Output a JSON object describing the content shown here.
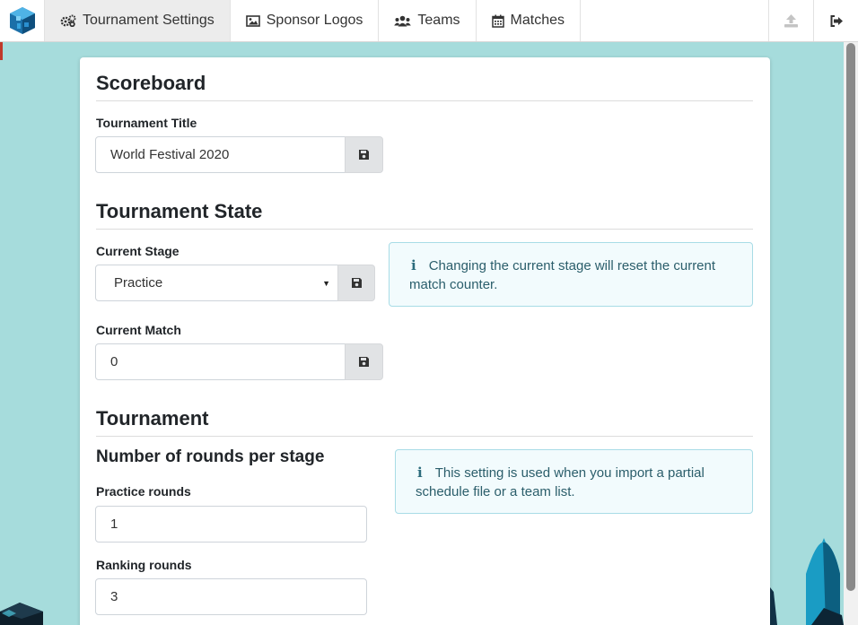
{
  "nav": {
    "tabs": [
      {
        "label": "Tournament Settings",
        "icon": "gears-icon",
        "active": true
      },
      {
        "label": "Sponsor Logos",
        "icon": "image-icon",
        "active": false
      },
      {
        "label": "Teams",
        "icon": "users-icon",
        "active": false
      },
      {
        "label": "Matches",
        "icon": "calendar-icon",
        "active": false
      }
    ],
    "right_buttons": [
      "upload-icon",
      "sign-out-icon"
    ]
  },
  "scoreboard": {
    "heading": "Scoreboard",
    "title_label": "Tournament Title",
    "title_value": "World Festival 2020"
  },
  "state": {
    "heading": "Tournament State",
    "stage_label": "Current Stage",
    "stage_value": "Practice",
    "stage_info": "Changing the current stage will reset the current match counter.",
    "match_label": "Current Match",
    "match_value": "0"
  },
  "tournament": {
    "heading": "Tournament",
    "rounds_heading": "Number of rounds per stage",
    "practice_label": "Practice rounds",
    "practice_value": "1",
    "ranking_label": "Ranking rounds",
    "ranking_value": "3",
    "rounds_info": "This setting is used when you import a partial schedule file or a team list."
  },
  "colors": {
    "background": "#a6dcdc",
    "info_bg": "#f2fbfd",
    "info_border": "#a8dce6",
    "info_text": "#2b5e6b"
  }
}
